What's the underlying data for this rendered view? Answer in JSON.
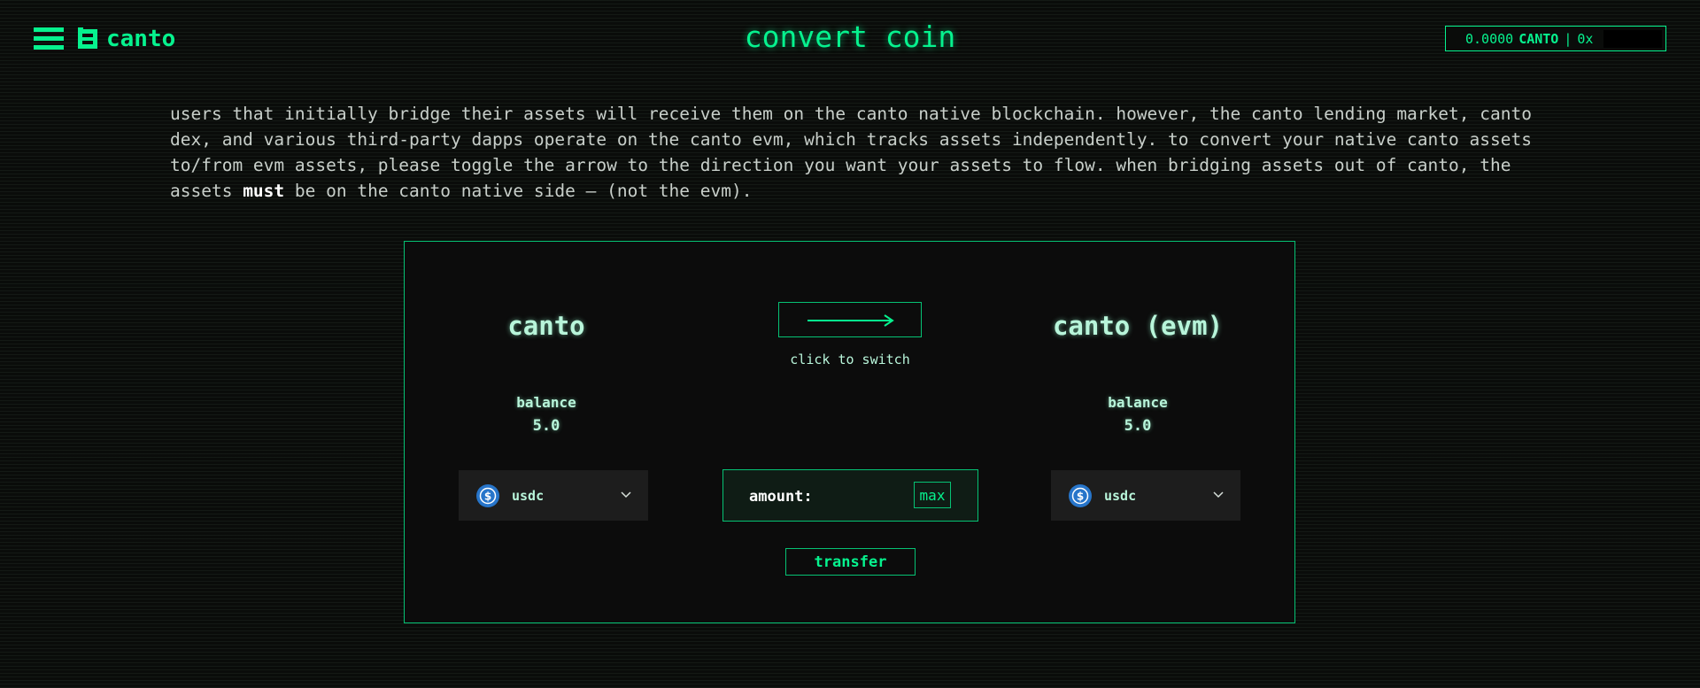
{
  "header": {
    "brand": "canto",
    "title": "convert coin",
    "wallet": {
      "balance": "0.0000",
      "token": "CANTO",
      "separator": "|",
      "address_prefix": "0x"
    },
    "accent_color": "#06f28e"
  },
  "description": {
    "part1": "users that initially bridge their assets will receive them on the canto native blockchain. however, the canto lending market, canto dex, and various third-party dapps operate on the canto evm, which tracks assets independently. to convert your native canto assets to/from evm assets, please toggle the arrow to the direction you want your assets to flow. when bridging assets out of canto, the assets ",
    "emphasis": "must",
    "part2": " be on the canto native side – (not the evm)."
  },
  "converter": {
    "left": {
      "title": "canto",
      "balance_label": "balance",
      "balance_value": "5.0",
      "token": "usdc",
      "token_icon": "usdc-coin-icon"
    },
    "right": {
      "title": "canto (evm)",
      "balance_label": "balance",
      "balance_value": "5.0",
      "token": "usdc",
      "token_icon": "usdc-coin-icon"
    },
    "switch_direction": "right-arrow",
    "switch_hint": "click to switch",
    "amount_label": "amount:",
    "amount_value": "",
    "max_label": "max",
    "transfer_label": "transfer"
  }
}
